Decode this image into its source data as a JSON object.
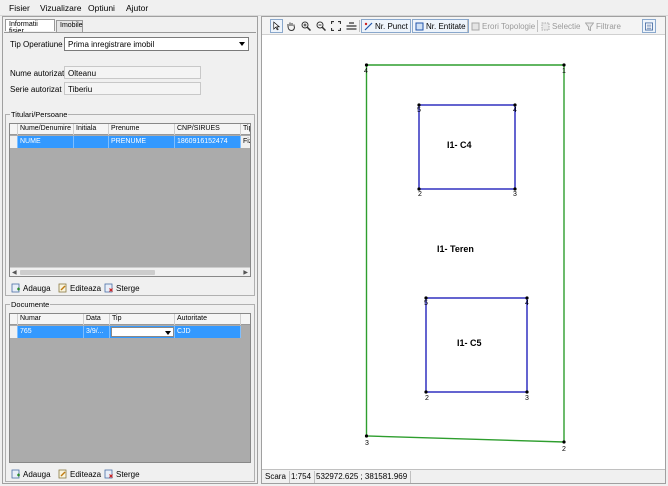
{
  "menu": [
    "Fisier",
    "Vizualizare",
    "Optiuni",
    "Ajutor"
  ],
  "tabs": [
    "Informatii fisier",
    "Imobile"
  ],
  "form": {
    "operation_label": "Tip Operatiune",
    "operation_value": "Prima inregistrare imobil",
    "name_label": "Nume autorizat",
    "name_value": "Olteanu",
    "serial_label": "Serie autorizat",
    "serial_value": "Tiberiu"
  },
  "persons": {
    "title": "Titulari/Persoane",
    "columns": [
      "Nume/Denumire",
      "Initiala",
      "Prenume",
      "CNP/SIRUES",
      "Tip"
    ],
    "rows": [
      [
        "NUME",
        "",
        "PRENUME",
        "1860916152474",
        "Fizic"
      ]
    ]
  },
  "documents": {
    "title": "Documente",
    "columns": [
      "Numar",
      "Data",
      "Tip",
      "Autoritate"
    ],
    "rows": [
      [
        "765",
        "3/9/...",
        "",
        "CJD"
      ]
    ]
  },
  "actions": {
    "add": "Adauga",
    "edit": "Editeaza",
    "delete": "Sterge"
  },
  "toolbar": {
    "nr_punct": "Nr. Punct",
    "nr_entitate": "Nr. Entitate",
    "erori": "Erori Topologie",
    "selectie": "Selectie",
    "filtrare": "Filtrare"
  },
  "map": {
    "parcel_label": "I1- Teren",
    "buildings": [
      {
        "label": "I1- C4",
        "points": [
          "5",
          "4",
          "2",
          "3"
        ]
      },
      {
        "label": "I1- C5",
        "points": [
          "5",
          "4",
          "2",
          "3"
        ]
      }
    ],
    "parcel_points": [
      "4",
      "1",
      "3",
      "2"
    ],
    "colors": {
      "parcel": "#2e9e2e",
      "building": "#2222bb"
    }
  },
  "status": {
    "scale_label": "Scara",
    "scale_value": "1:754",
    "coords": "532972.625 ; 381581.969"
  },
  "icons": [
    "cursor-icon",
    "hand-icon",
    "zoom-in-icon",
    "zoom-out-icon",
    "zoom-extent-icon",
    "measure-icon",
    "layers-icon"
  ]
}
